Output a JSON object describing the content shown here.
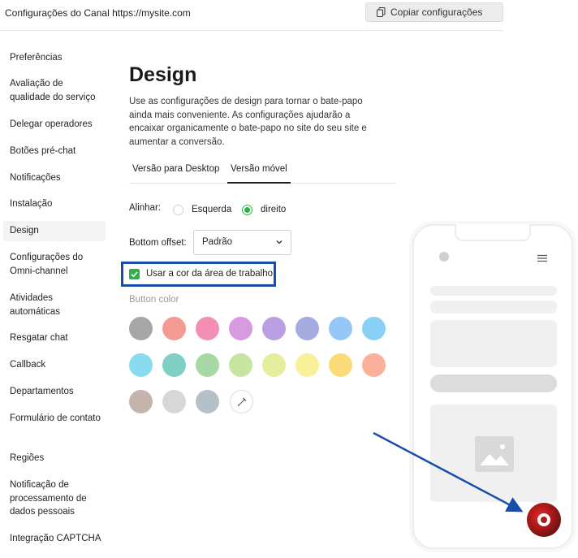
{
  "header": {
    "title": "Configurações do Canal https://mysite.com",
    "copy_button": "Copiar configurações"
  },
  "sidebar": {
    "items": [
      {
        "label": "Preferências",
        "active": false
      },
      {
        "label": "Avaliação de qualidade do serviço",
        "active": false
      },
      {
        "label": "Delegar operadores",
        "active": false
      },
      {
        "label": "Botões pré-chat",
        "active": false
      },
      {
        "label": "Notificações",
        "active": false
      },
      {
        "label": "Instalação",
        "active": false
      },
      {
        "label": "Design",
        "active": true
      },
      {
        "label": "Configurações do Omni-channel",
        "active": false
      },
      {
        "label": "Atividades automáticas",
        "active": false
      },
      {
        "label": "Resgatar chat",
        "active": false
      },
      {
        "label": "Callback",
        "active": false
      },
      {
        "label": "Departamentos",
        "active": false
      },
      {
        "label": "Formulário de contato",
        "active": false
      },
      {
        "label": "Regiões",
        "active": false
      },
      {
        "label": "Notificação de processamento de dados pessoais",
        "active": false
      },
      {
        "label": "Integração CAPTCHA",
        "active": false
      }
    ]
  },
  "main": {
    "title": "Design",
    "description": "Use as configurações de design para tornar o bate-papo ainda mais conveniente. As configurações ajudarão a encaixar organicamente o bate-papo no site do seu site e aumentar a conversão.",
    "tabs": [
      {
        "label": "Versão para Desktop",
        "active": false
      },
      {
        "label": "Versão móvel",
        "active": true
      }
    ],
    "align": {
      "label": "Alinhar:",
      "options": [
        {
          "label": "Esquerda",
          "checked": false
        },
        {
          "label": "direito",
          "checked": true
        }
      ]
    },
    "bottom_offset": {
      "label": "Bottom offset:",
      "value": "Padrão"
    },
    "use_workspace_color": {
      "label": "Usar a cor da área de trabalho",
      "checked": true
    },
    "button_color": {
      "label": "Button color",
      "swatches": [
        "#a6a6a6",
        "#f39a94",
        "#f38fb4",
        "#d79ae0",
        "#b9a0e5",
        "#a5abde",
        "#95c8f6",
        "#89d0f6",
        "#89dced",
        "#7fcfc4",
        "#a6d8a5",
        "#c8e4a1",
        "#e5ee9f",
        "#f8f19a",
        "#fbdb78",
        "#fbb099",
        "#c5b4ae",
        "#d7d7d7",
        "#b6c1c7"
      ]
    }
  },
  "colors": {
    "accent_green": "#2eb14a",
    "highlight_blue": "#174fa8",
    "chat_button": "#c21f1f"
  }
}
